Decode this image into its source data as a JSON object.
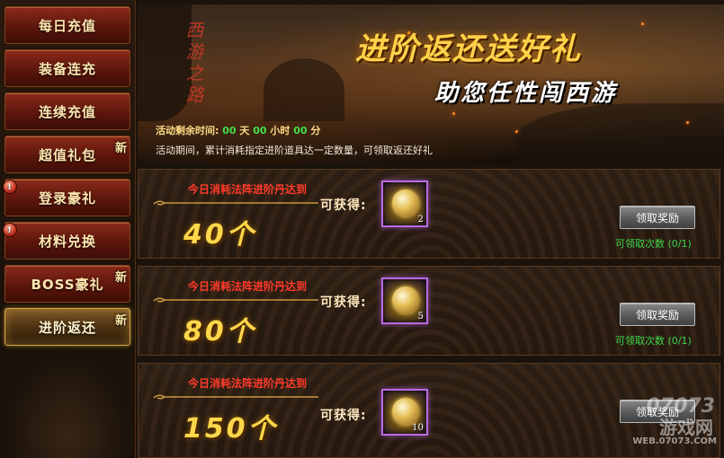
{
  "sidebar": {
    "items": [
      {
        "label": "每日充值",
        "badge": "",
        "alert": ""
      },
      {
        "label": "装备连充",
        "badge": "",
        "alert": ""
      },
      {
        "label": "连续充值",
        "badge": "",
        "alert": ""
      },
      {
        "label": "超值礼包",
        "badge": "新",
        "alert": ""
      },
      {
        "label": "登录豪礼",
        "badge": "",
        "alert": "!"
      },
      {
        "label": "材料兑换",
        "badge": "",
        "alert": "!"
      },
      {
        "label": "BOSS豪礼",
        "badge": "新",
        "alert": ""
      },
      {
        "label": "进阶返还",
        "badge": "新",
        "alert": "",
        "active": true
      }
    ]
  },
  "banner": {
    "calligraphy": "西游之路",
    "title": "进阶返还送好礼",
    "subtitle": "助您任性闯西游",
    "timer": {
      "label": "活动剩余时间:",
      "days": "00",
      "days_unit": "天",
      "hours": "00",
      "hours_unit": "小时",
      "minutes": "00",
      "minutes_unit": "分"
    },
    "period_text": "活动期间，累计消耗指定进阶道具达一定数量，可领取返还好礼"
  },
  "rewards": [
    {
      "goal": "今日消耗法阵进阶丹达到",
      "amount": "40个",
      "gain_label": "可获得:",
      "item_qty": "2",
      "claim_label": "领取奖励",
      "count_text": "可领取次数 (0/1)"
    },
    {
      "goal": "今日消耗法阵进阶丹达到",
      "amount": "80个",
      "gain_label": "可获得:",
      "item_qty": "5",
      "claim_label": "领取奖励",
      "count_text": "可领取次数 (0/1)"
    },
    {
      "goal": "今日消耗法阵进阶丹达到",
      "amount": "150个",
      "gain_label": "可获得:",
      "item_qty": "10",
      "claim_label": "领取奖励",
      "count_text": ""
    }
  ],
  "watermark": {
    "logo": "07073",
    "site": "游戏网",
    "url": "WEB.07073.COM"
  },
  "colors": {
    "accent_gold": "#ffd74a",
    "goal_red": "#ff3a2a",
    "count_green": "#3fd64a",
    "item_border_purple": "#b86be0"
  }
}
